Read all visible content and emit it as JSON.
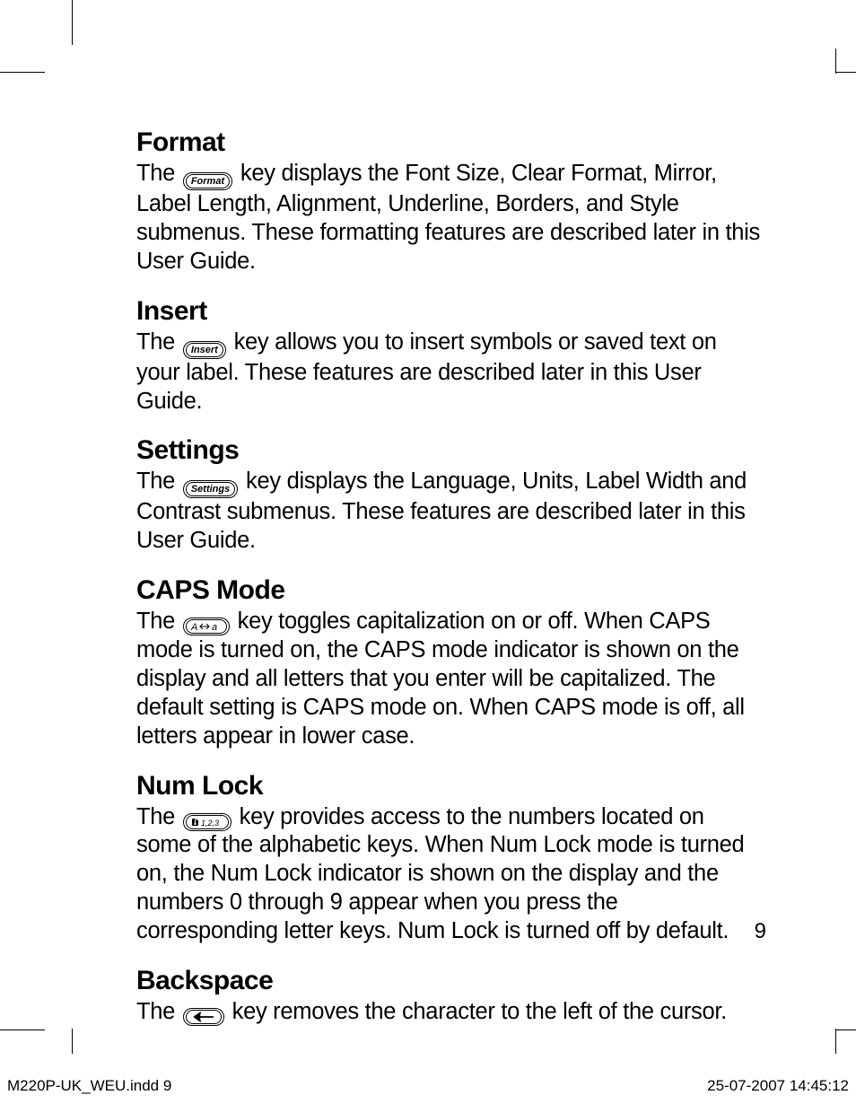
{
  "sections": {
    "format": {
      "heading": "Format",
      "key_label": "Format",
      "pre": "The ",
      "post": " key displays the Font Size, Clear Format, Mirror, Label Length, Alignment, Underline, Borders, and Style submenus. These formatting features are described later in this User Guide."
    },
    "insert": {
      "heading": "Insert",
      "key_label": "Insert",
      "pre": "The ",
      "post": " key allows you to insert symbols or saved text on your label. These features are described later in this User Guide."
    },
    "settings": {
      "heading": "Settings",
      "key_label": "Settings",
      "pre": "The ",
      "post": " key displays the Language, Units, Label Width and Contrast submenus. These features are described later in this User Guide."
    },
    "caps": {
      "heading": "CAPS Mode",
      "pre": "The ",
      "post": " key toggles capitalization on or off. When CAPS mode is turned on, the CAPS mode indicator is shown on the display and all letters that you enter will be capitalized. The default setting is CAPS mode on. When CAPS mode is off, all letters appear in lower case."
    },
    "numlock": {
      "heading": "Num Lock",
      "pre": "The ",
      "post": " key provides access to the numbers located on some of the alphabetic keys. When Num Lock mode is turned on, the Num Lock indicator is shown on the display and the numbers 0 through 9 appear when you press the corresponding letter keys. Num Lock is turned off by default."
    },
    "backspace": {
      "heading": "Backspace",
      "pre": "The ",
      "post": " key removes the character to the left of the cursor."
    }
  },
  "page_number": "9",
  "footer": {
    "file": "M220P-UK_WEU.indd   9",
    "datetime": "25-07-2007   14:45:12"
  }
}
